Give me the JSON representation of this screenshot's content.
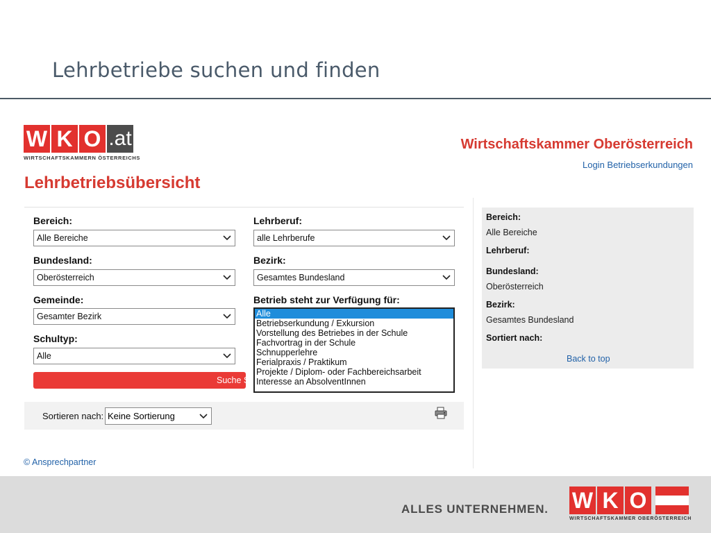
{
  "slide": {
    "title": "Lehrbetriebe suchen und finden"
  },
  "header": {
    "logo_letters": [
      "W",
      "K",
      "O"
    ],
    "logo_suffix": ".at",
    "logo_subtitle": "WIRTSCHAFTSKAMMERN ÖSTERREICHS",
    "org_name": "Wirtschaftskammer Oberösterreich",
    "login_link": "Login Betriebserkundungen"
  },
  "page": {
    "heading": "Lehrbetriebsübersicht"
  },
  "form": {
    "bereich": {
      "label": "Bereich:",
      "value": "Alle Bereiche"
    },
    "lehrberuf": {
      "label": "Lehrberuf:",
      "value": "alle Lehrberufe"
    },
    "bundesland": {
      "label": "Bundesland:",
      "value": "Oberösterreich"
    },
    "bezirk": {
      "label": "Bezirk:",
      "value": "Gesamtes Bundesland"
    },
    "gemeinde": {
      "label": "Gemeinde:",
      "value": "Gesamter Bezirk"
    },
    "verfuegung": {
      "label": "Betrieb steht zur Verfügung für:",
      "options": [
        "Alle",
        "Betriebserkundung / Exkursion",
        "Vorstellung des Betriebes in der Schule",
        "Fachvortrag in der Schule",
        "Schnupperlehre",
        "Ferialpraxis / Praktikum",
        "Projekte / Diplom- oder Fachbereichsarbeit",
        "Interesse an AbsolventInnen"
      ],
      "selected": "Alle"
    },
    "schultyp": {
      "label": "Schultyp:",
      "value": "Alle"
    },
    "search_button": "Suche Sta"
  },
  "sort": {
    "label": "Sortieren nach:",
    "value": "Keine Sortierung"
  },
  "summary": {
    "bereich_label": "Bereich:",
    "bereich_value": "Alle Bereiche",
    "lehrberuf_label": "Lehrberuf:",
    "bundesland_label": "Bundesland:",
    "bundesland_value": "Oberösterreich",
    "bezirk_label": "Bezirk:",
    "bezirk_value": "Gesamtes Bundesland",
    "sortiert_label": "Sortiert nach:",
    "back_to_top": "Back to top"
  },
  "footer_links": {
    "contact": "© Ansprechpartner"
  },
  "footer": {
    "tagline": "ALLES UNTERNEHMEN.",
    "logo_subtitle": "WIRTSCHAFTSKAMMER OBERÖSTERREICH"
  },
  "colors": {
    "brand_red": "#e2312e",
    "heading_red": "#d63a31",
    "link_blue": "#2262a8",
    "selection_blue": "#1f8ddb"
  },
  "icons": [
    "chevron-down-icon",
    "print-icon"
  ]
}
